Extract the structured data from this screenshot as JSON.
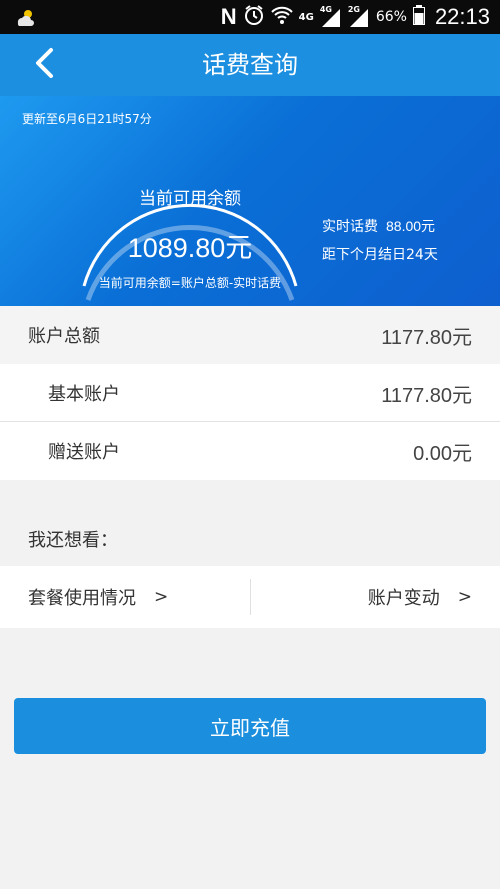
{
  "status_bar": {
    "weather_icon": "cloud-sun-icon",
    "n_label": "N",
    "signal_4g_label": "4G",
    "signal_4g_small": "4G",
    "signal_2g_small": "2G",
    "battery_percent": "66%",
    "time": "22:13"
  },
  "header": {
    "title": "话费查询",
    "back_icon": "chevron-left-icon",
    "color": "#1d8fe0"
  },
  "balance": {
    "updated_text": "更新至6月6日21时57分",
    "label": "当前可用余额",
    "amount": "1089.80元",
    "formula": "当前可用余额=账户总额-实时话费",
    "realtime_fee_label": "实时话费",
    "realtime_fee_value": "88.00元",
    "bill_days": "距下个月结日24天"
  },
  "accounts": {
    "total": {
      "label": "账户总额",
      "amount": "1177.80元"
    },
    "basic": {
      "label": "基本账户",
      "amount": "1177.80元"
    },
    "gift": {
      "label": "赠送账户",
      "amount": "0.00元"
    }
  },
  "more": {
    "label": "我还想看：",
    "package_usage": "套餐使用情况",
    "account_changes": "账户变动",
    "arrow": ">"
  },
  "recharge_button": "立即充值"
}
